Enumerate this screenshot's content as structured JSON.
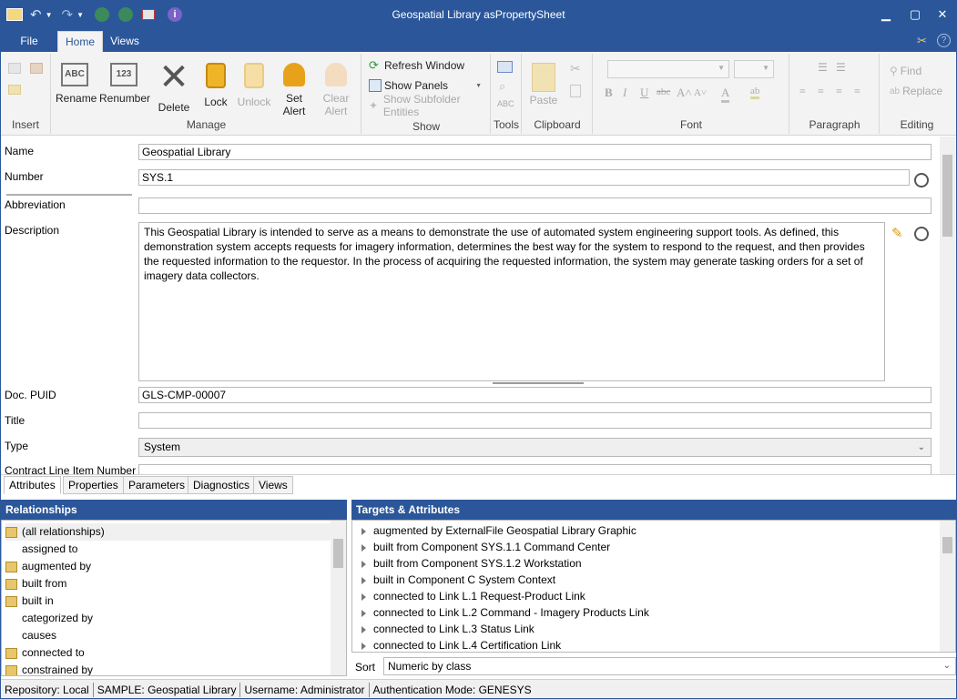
{
  "window": {
    "title": "Geospatial Library asPropertySheet"
  },
  "ribbon_tabs": [
    "File",
    "Home",
    "Views"
  ],
  "ribbon": {
    "insert": {
      "label": "Insert"
    },
    "manage": {
      "label": "Manage",
      "rename": "Rename",
      "renumber": "Renumber",
      "delete": "Delete",
      "lock": "Lock",
      "unlock": "Unlock",
      "set_alert": "Set\nAlert",
      "clear_alert": "Clear\nAlert"
    },
    "show": {
      "label": "Show",
      "refresh": "Refresh Window",
      "panels": "Show Panels",
      "subfolder": "Show Subfolder Entities"
    },
    "tools": {
      "label": "Tools"
    },
    "clipboard": {
      "label": "Clipboard",
      "paste": "Paste"
    },
    "font": {
      "label": "Font"
    },
    "paragraph": {
      "label": "Paragraph"
    },
    "editing": {
      "label": "Editing",
      "find": "Find",
      "replace": "Replace"
    }
  },
  "fields": {
    "name": {
      "label": "Name",
      "value": "Geospatial Library"
    },
    "number": {
      "label": "Number",
      "value": "SYS.1"
    },
    "abbreviation": {
      "label": "Abbreviation",
      "value": ""
    },
    "description": {
      "label": "Description",
      "value": "This Geospatial Library is intended to serve as a means to demonstrate the use of automated system engineering support tools. As defined, this demonstration system accepts requests for imagery information, determines the best way for the system to respond to the request, and then provides the requested information to the requestor. In the process of acquiring the requested information, the system may generate tasking orders for a set of imagery data collectors."
    },
    "doc_puid": {
      "label": "Doc. PUID",
      "value": "GLS-CMP-00007"
    },
    "title": {
      "label": "Title",
      "value": ""
    },
    "type": {
      "label": "Type",
      "value": "System"
    },
    "contract_line": {
      "label": "Contract Line Item Number",
      "value": ""
    }
  },
  "bottom_tabs": [
    "Attributes",
    "Properties",
    "Parameters",
    "Diagnostics",
    "Views"
  ],
  "relationships": {
    "header": "Relationships",
    "items": [
      {
        "label": "(all relationships)",
        "folder": true
      },
      {
        "label": "assigned to",
        "folder": false
      },
      {
        "label": "augmented by",
        "folder": true
      },
      {
        "label": "built from",
        "folder": true
      },
      {
        "label": "built in",
        "folder": true
      },
      {
        "label": "categorized by",
        "folder": false
      },
      {
        "label": "causes",
        "folder": false
      },
      {
        "label": "connected to",
        "folder": true
      },
      {
        "label": "constrained by",
        "folder": true
      }
    ]
  },
  "targets": {
    "header": "Targets & Attributes",
    "items": [
      "augmented by ExternalFile  Geospatial Library Graphic",
      "built from Component SYS.1.1 Command Center",
      "built from Component SYS.1.2 Workstation",
      "built in Component C System Context",
      "connected to Link L.1 Request-Product Link",
      "connected to Link L.2 Command - Imagery Products Link",
      "connected to Link L.3 Status Link",
      "connected to Link L.4 Certification Link"
    ]
  },
  "sort": {
    "label": "Sort",
    "value": "Numeric by class"
  },
  "status": [
    "Repository: Local",
    "SAMPLE: Geospatial Library",
    "Username: Administrator",
    "Authentication Mode: GENESYS"
  ],
  "colors": {
    "accent": "#2b579a",
    "ribbon_bg": "#f3f3f3",
    "folder": "#e8c76c"
  }
}
